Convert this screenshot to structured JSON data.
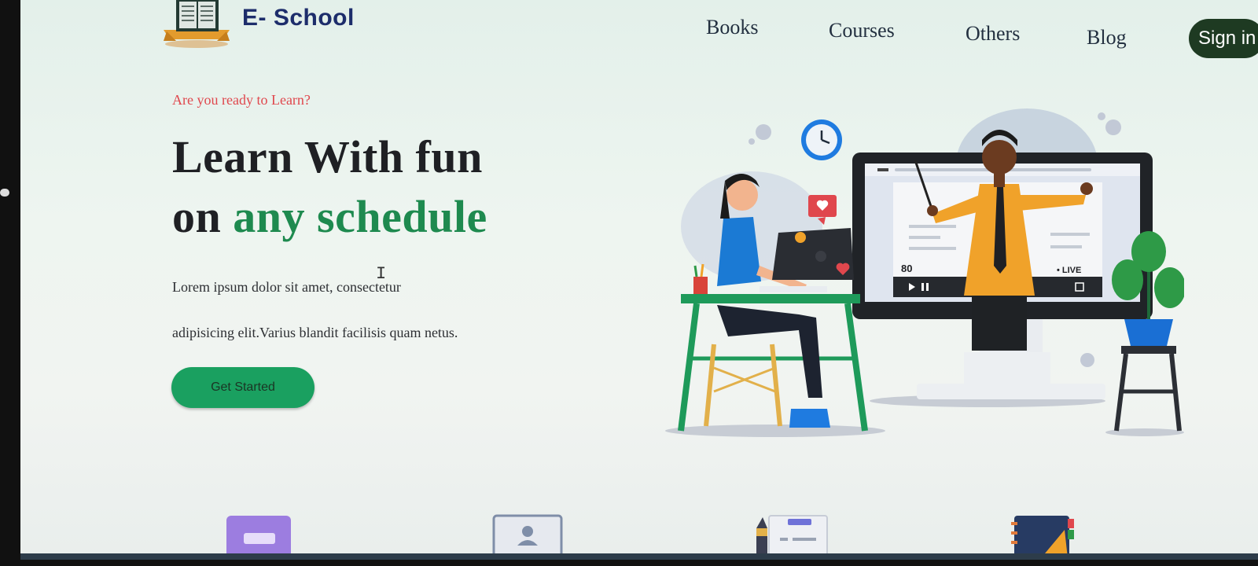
{
  "header": {
    "brand": "E- School",
    "nav": [
      {
        "label": "Books"
      },
      {
        "label": "Courses"
      },
      {
        "label": "Others"
      },
      {
        "label": "Blog"
      }
    ],
    "signin_label": "Sign in"
  },
  "hero": {
    "eyebrow": "Are you ready to Learn?",
    "headline_line1": "Learn With fun",
    "headline_line2_prefix": "on ",
    "headline_line2_accent": "any schedule",
    "description_line1": "Lorem ipsum dolor sit amet, consectetur",
    "description_line2": "adipisicing elit.Varius blandit facilisis quam netus.",
    "cta_label": "Get Started"
  },
  "illustration": {
    "viewer_count": "80",
    "live_label": "• LIVE"
  },
  "colors": {
    "accent": "#1e8a4f",
    "cta": "#1aa060",
    "eyebrow": "#e0474d",
    "signin_bg": "#1e3a22",
    "brand": "#1d2d6b"
  },
  "icons": [
    "book-logo-icon",
    "book-category-icon",
    "profile-card-icon",
    "pen-notebook-icon",
    "geometry-notebook-icon"
  ]
}
